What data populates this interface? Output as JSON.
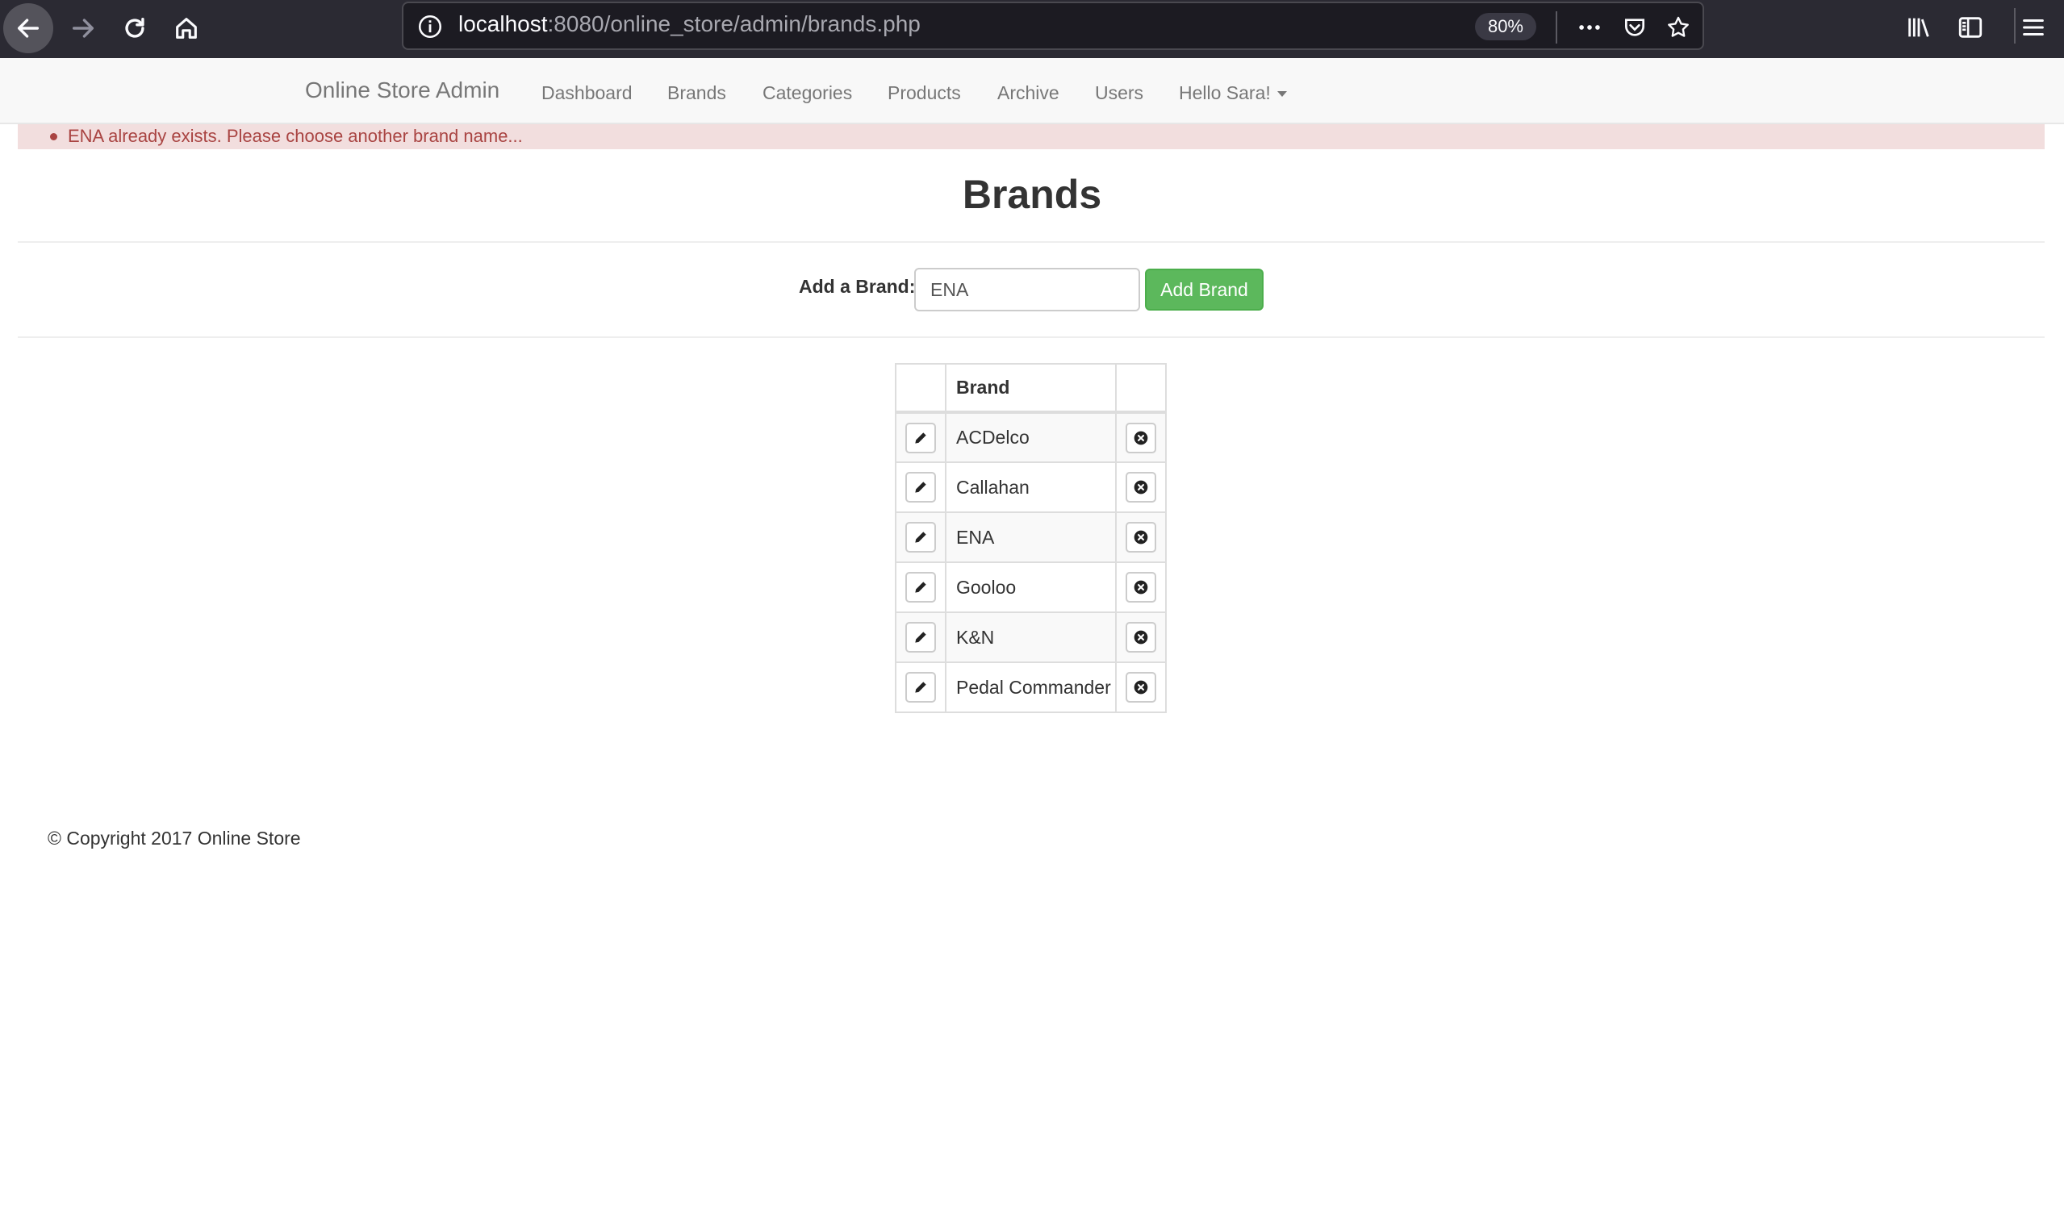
{
  "browser": {
    "url_host": "localhost",
    "url_rest": ":8080/online_store/admin/brands.php",
    "zoom": "80%"
  },
  "navbar": {
    "brand": "Online Store Admin",
    "items": [
      {
        "label": "Dashboard"
      },
      {
        "label": "Brands"
      },
      {
        "label": "Categories"
      },
      {
        "label": "Products"
      },
      {
        "label": "Archive"
      },
      {
        "label": "Users"
      },
      {
        "label": "Hello Sara!"
      }
    ]
  },
  "alert": {
    "message": "ENA already exists. Please choose another brand name..."
  },
  "page": {
    "title": "Brands"
  },
  "form": {
    "label": "Add a Brand:",
    "input_value": "ENA",
    "button_label": "Add Brand"
  },
  "table": {
    "header": "Brand",
    "rows": [
      {
        "name": "ACDelco"
      },
      {
        "name": "Callahan"
      },
      {
        "name": "ENA"
      },
      {
        "name": "Gooloo"
      },
      {
        "name": "K&N"
      },
      {
        "name": "Pedal Commander"
      }
    ]
  },
  "footer": {
    "text": "© Copyright 2017 Online Store"
  },
  "colors": {
    "success": "#5cb85c",
    "alert_bg": "#f2dede",
    "alert_text": "#a94442",
    "chrome_bg": "#2b2a33"
  }
}
